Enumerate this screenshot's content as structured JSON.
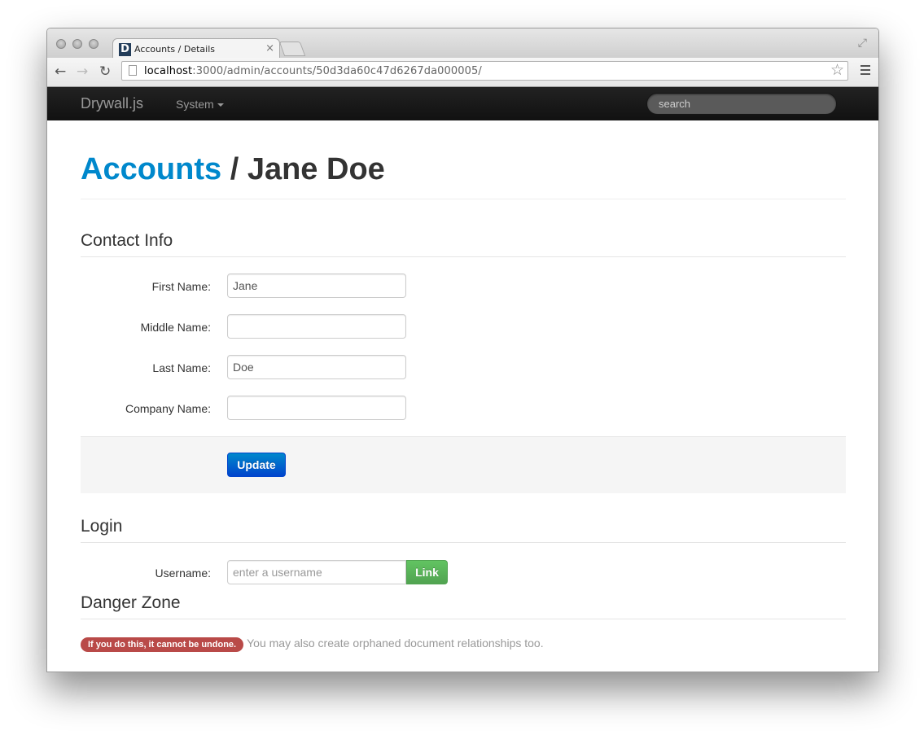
{
  "browser": {
    "tab_title": "Accounts / Details",
    "favicon_letter": "D",
    "url_host": "localhost",
    "url_path": ":3000/admin/accounts/50d3da60c47d6267da000005/"
  },
  "navbar": {
    "brand": "Drywall.js",
    "system_menu": "System",
    "search_placeholder": "search"
  },
  "header": {
    "breadcrumb_link": "Accounts",
    "separator": " / ",
    "name": "Jane Doe"
  },
  "contact": {
    "title": "Contact Info",
    "fields": [
      {
        "label": "First Name:",
        "value": "Jane"
      },
      {
        "label": "Middle Name:",
        "value": ""
      },
      {
        "label": "Last Name:",
        "value": "Doe"
      },
      {
        "label": "Company Name:",
        "value": ""
      }
    ],
    "update_label": "Update"
  },
  "login": {
    "title": "Login",
    "username_label": "Username:",
    "username_placeholder": "enter a username",
    "link_label": "Link"
  },
  "danger": {
    "title": "Danger Zone",
    "warning_badge": "If you do this, it cannot be undone.",
    "note": "You may also create orphaned document relationships too."
  }
}
